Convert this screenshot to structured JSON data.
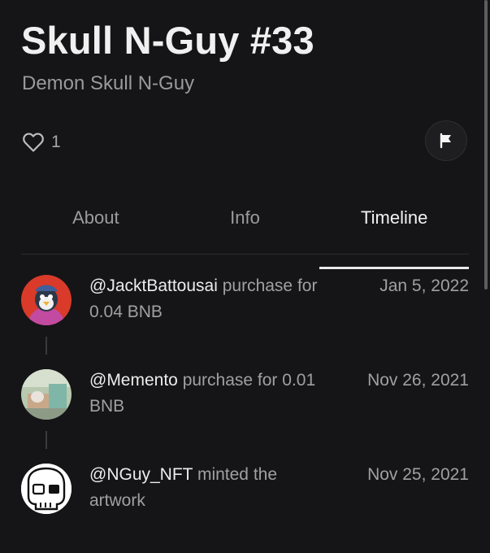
{
  "item": {
    "title": "Skull N-Guy #33",
    "subtitle": "Demon Skull N-Guy",
    "like_count": "1"
  },
  "tabs": [
    {
      "label": "About",
      "active": false
    },
    {
      "label": "Info",
      "active": false
    },
    {
      "label": "Timeline",
      "active": true
    }
  ],
  "timeline": [
    {
      "user": "@JacktBattousai",
      "action": " purchase for 0.04 BNB",
      "date": "Jan 5, 2022"
    },
    {
      "user": "@Memento",
      "action": " purchase for 0.01 BNB",
      "date": "Nov 26, 2021"
    },
    {
      "user": "@NGuy_NFT",
      "action": " minted the artwork",
      "date": "Nov 25, 2021"
    }
  ],
  "icons": {
    "like": "heart-outline-icon",
    "report": "flag-icon"
  },
  "colors": {
    "background": "#151517",
    "text_primary": "#ededed",
    "text_secondary": "#9a9a9d"
  }
}
